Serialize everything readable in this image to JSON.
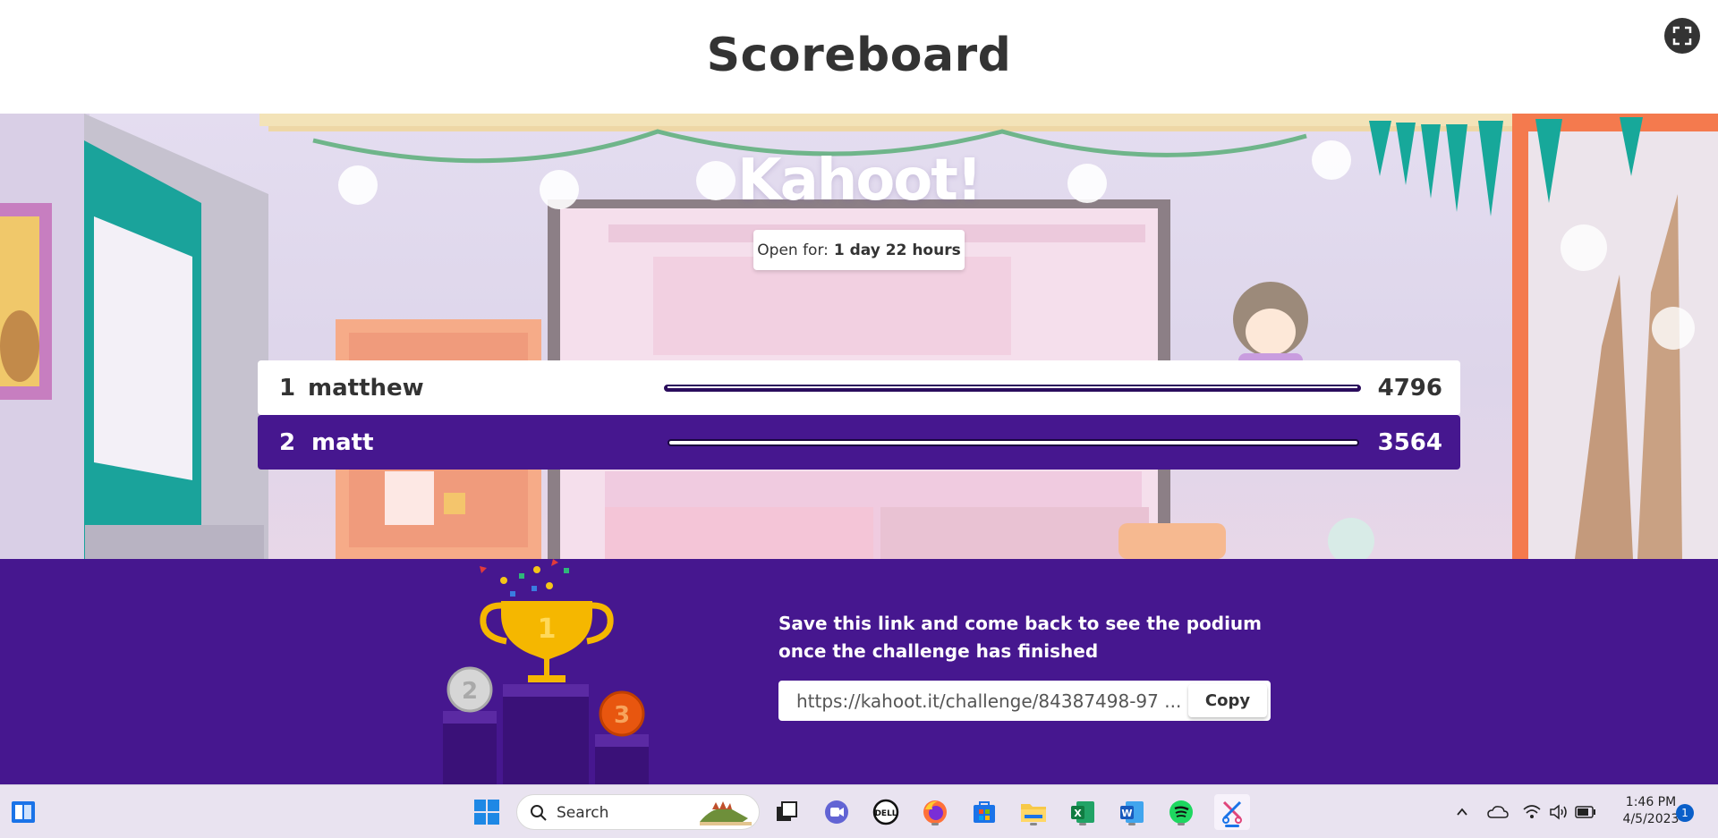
{
  "header": {
    "title": "Scoreboard"
  },
  "scene": {
    "logo": "Kahoot!",
    "open_for_label": "Open for:",
    "open_for_value": "1 day 22 hours"
  },
  "scoreboard": {
    "rows": [
      {
        "rank": "1",
        "name": "matthew",
        "score": "4796"
      },
      {
        "rank": "2",
        "name": "matt",
        "score": "3564"
      }
    ]
  },
  "footer": {
    "save_message": "Save this link and come back to see the podium once the challenge has finished",
    "link_value": "https://kahoot.it/challenge/84387498-97 ...",
    "copy_label": "Copy"
  },
  "taskbar": {
    "search_placeholder": "Search",
    "time": "1:46 PM",
    "date": "4/5/2023",
    "notification_count": "1",
    "apps": [
      "widgets-icon",
      "start-icon",
      "task-view-icon",
      "teams-chat-icon",
      "dell-icon",
      "firefox-icon",
      "store-icon",
      "file-explorer-icon",
      "excel-icon",
      "word-icon",
      "spotify-icon",
      "snipping-tool-icon"
    ]
  },
  "colors": {
    "kahoot_purple": "#46178f",
    "title_text": "#333333"
  }
}
